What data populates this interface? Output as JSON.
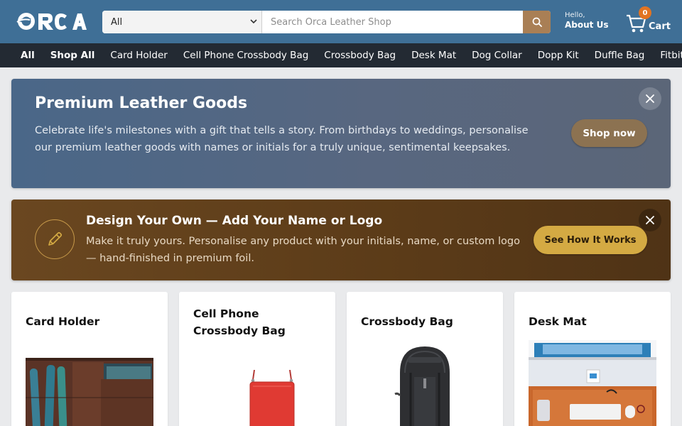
{
  "header": {
    "logo_text": "ORCA",
    "search": {
      "category": "All",
      "placeholder": "Search Orca Leather Shop"
    },
    "account": {
      "greeting": "Hello,",
      "label": "About Us"
    },
    "cart": {
      "count": "0",
      "label": "Cart"
    }
  },
  "nav": {
    "items": [
      "All",
      "Shop All",
      "Card Holder",
      "Cell Phone Crossbody Bag",
      "Crossbody Bag",
      "Desk Mat",
      "Dog Collar",
      "Dopp Kit",
      "Duffle Bag",
      "Fitbit Wa"
    ]
  },
  "promo": {
    "title": "Premium Leather Goods",
    "text": "Celebrate life's milestones with a gift that tells a story. From birthdays to weddings, personalise our premium leather goods with names or initials for a truly unique, sentimental keepsakes.",
    "button": "Shop now"
  },
  "design": {
    "title": "Design Your Own — Add Your Name or Logo",
    "text": "Make it truly yours. Personalise any product with your initials, name, or custom logo — hand-finished in premium foil.",
    "button": "See How It Works"
  },
  "products": [
    {
      "title": "Card Holder",
      "icon": "card-holder-image"
    },
    {
      "title": "Cell Phone Crossbody Bag",
      "icon": "crossbody-phone-bag-image"
    },
    {
      "title": "Crossbody Bag",
      "icon": "backpack-image"
    },
    {
      "title": "Desk Mat",
      "icon": "desk-mat-image"
    }
  ],
  "colors": {
    "header_bg": "#3f6f96",
    "nav_bg": "#232a33",
    "search_button": "#a97f55",
    "cart_badge": "#e27422",
    "promo_button": "#8c7251",
    "design_button": "#d4aa43"
  }
}
